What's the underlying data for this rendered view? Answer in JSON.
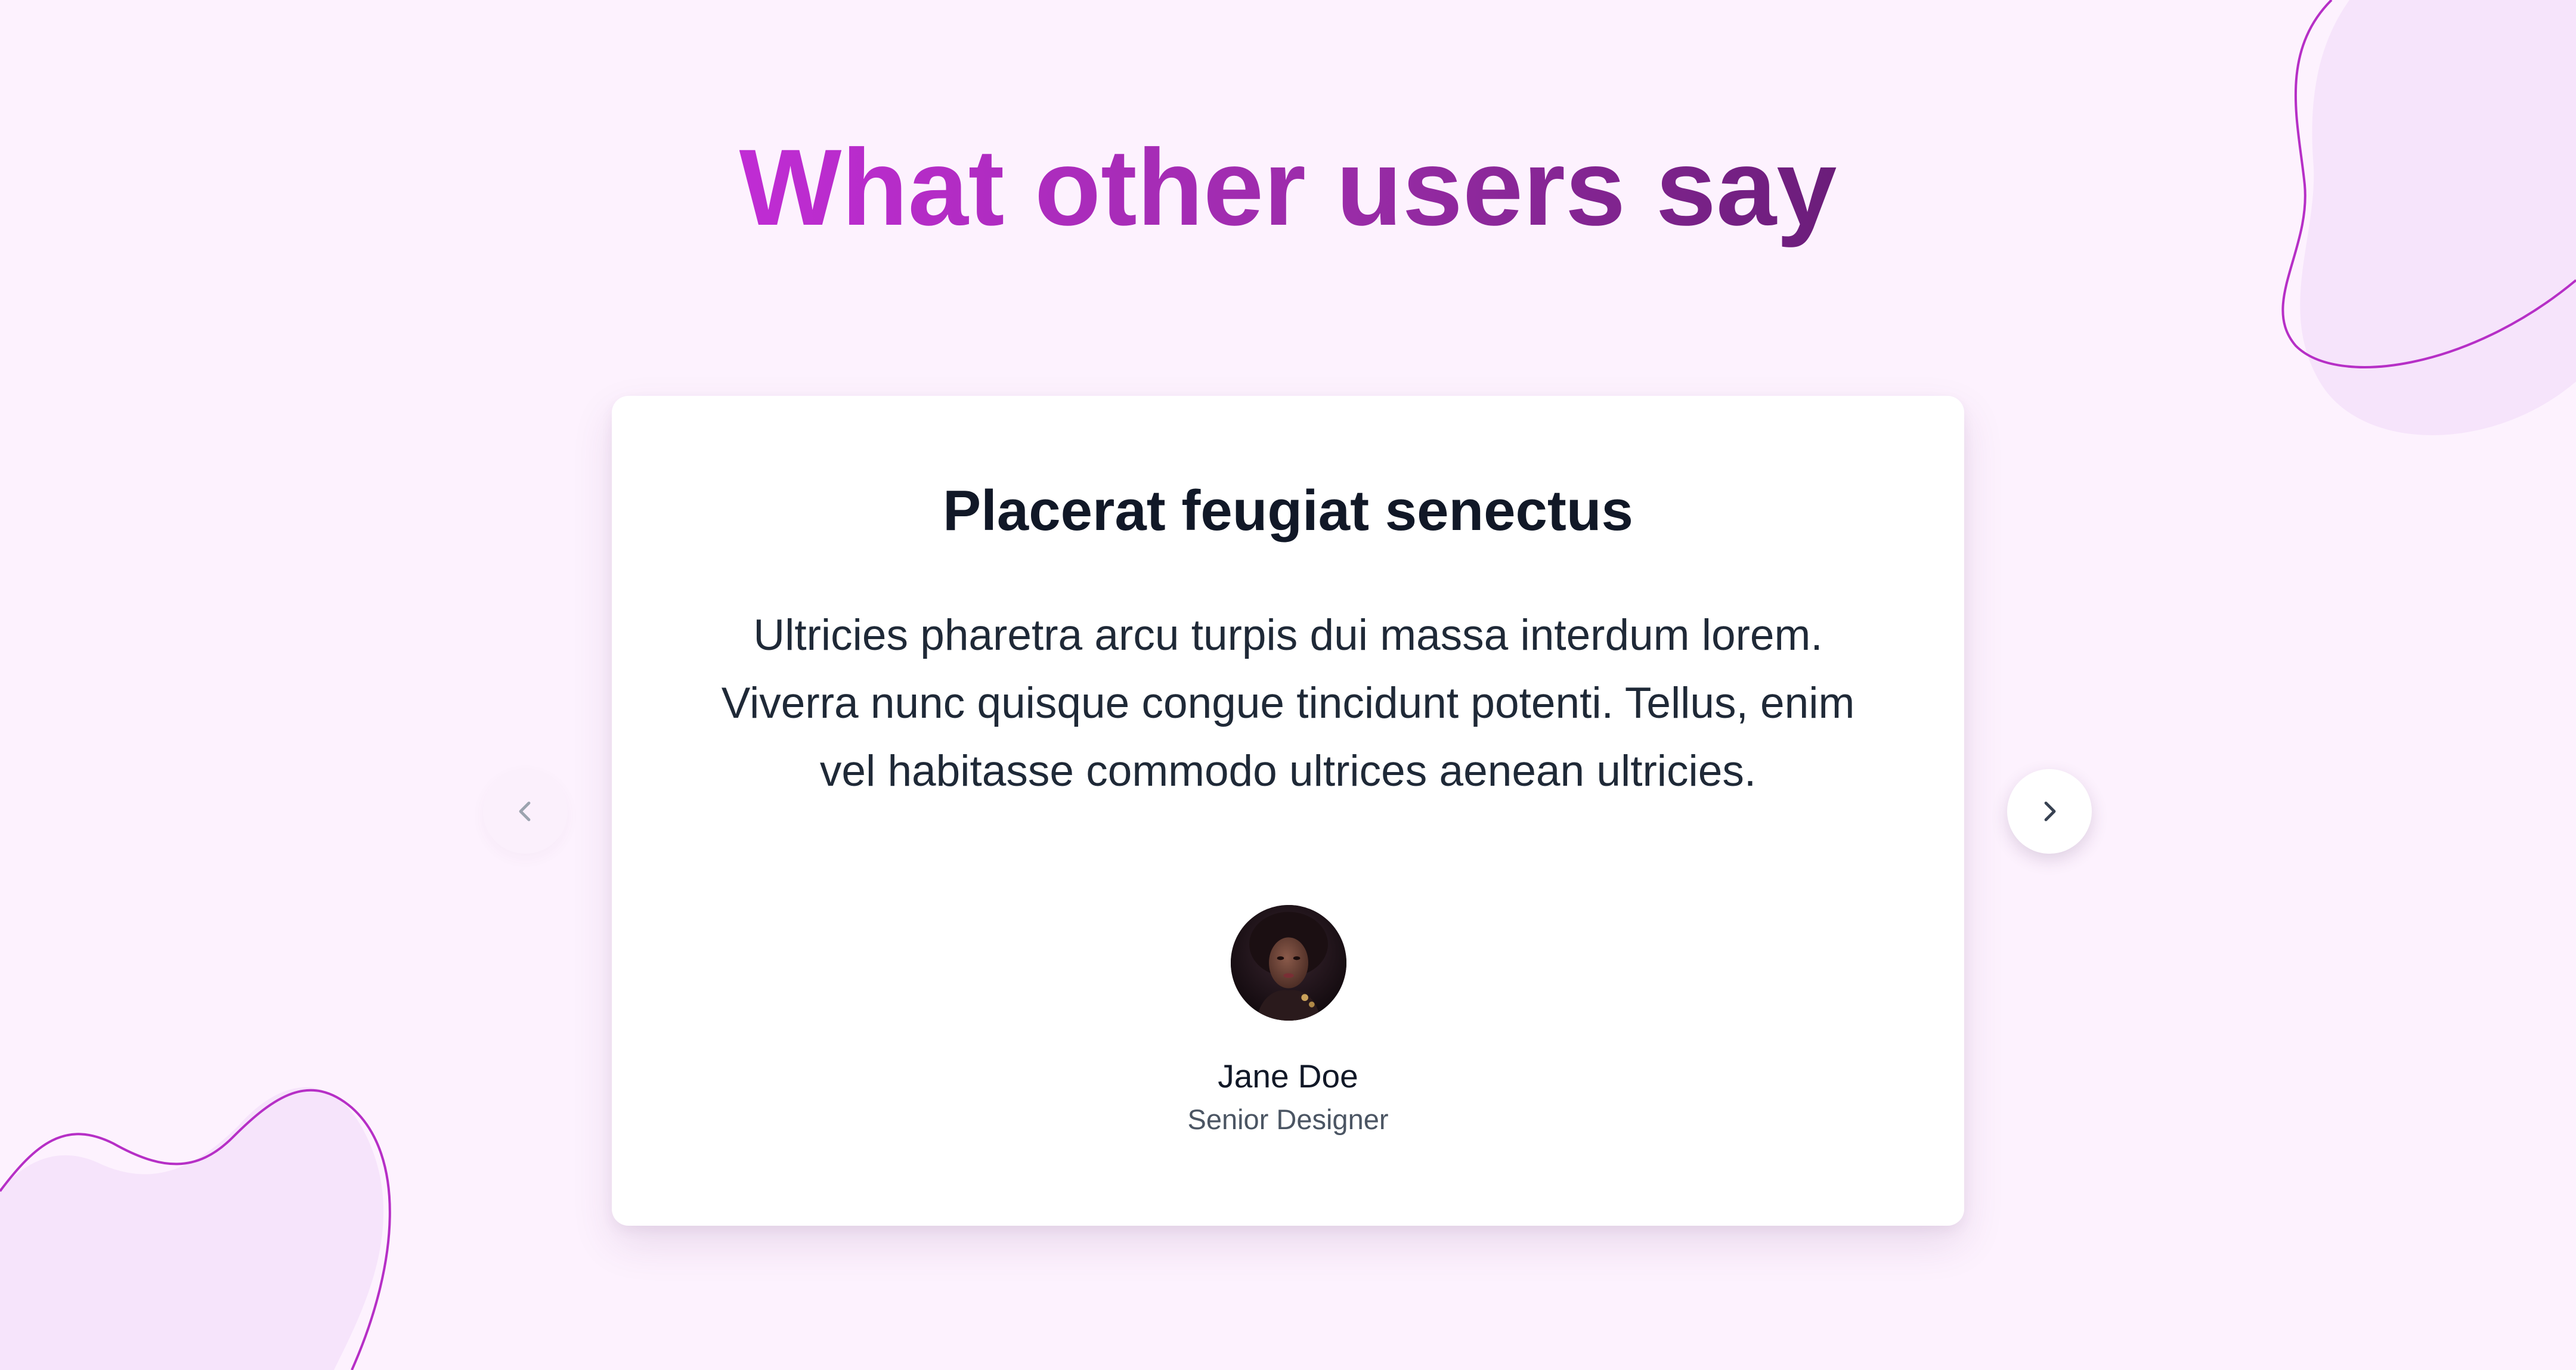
{
  "section": {
    "heading": "What other users say"
  },
  "testimonial": {
    "title": "Placerat feugiat senectus",
    "quote": "Ultricies pharetra arcu turpis dui massa interdum lorem. Viverra nunc quisque congue tincidunt potenti. Tellus, enim vel habitasse commodo ultrices aenean ultricies.",
    "author": {
      "name": "Jane Doe",
      "role": "Senior Designer",
      "avatar_icon": "user-portrait"
    }
  },
  "carousel": {
    "prev_icon": "chevron-left-icon",
    "next_icon": "chevron-right-icon",
    "prev_enabled": false,
    "next_enabled": true
  },
  "colors": {
    "background": "#fdf2fe",
    "heading_gradient_start": "#c02cd4",
    "heading_gradient_end": "#6b1d7a",
    "blob_fill": "#f6e4fb",
    "blob_stroke": "#b62fc6",
    "card": "#ffffff",
    "title_text": "#111827",
    "role_text": "#4b5563"
  }
}
